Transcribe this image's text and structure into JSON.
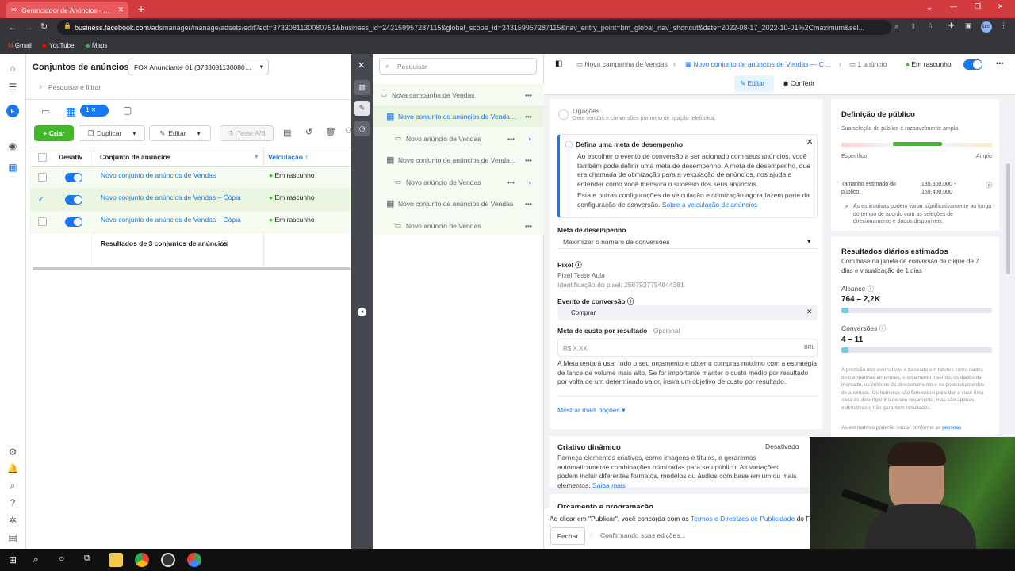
{
  "browser": {
    "tab_title": "Gerenciador de Anúncios - Gere",
    "url_host": "business.facebook.com",
    "url_path": "/adsmanager/manage/adsets/edit?act=3733081130080751&business_id=243159957287115&global_scope_id=243159957287115&nav_entry_point=bm_global_nav_shortcut&date=2022-08-17_2022-10-01%2Cmaximum&sel...",
    "bookmarks": [
      "Gmail",
      "YouTube",
      "Maps"
    ],
    "profile": "bm"
  },
  "panel": {
    "title": "Conjuntos de anúncios",
    "account": "FOX Anunciante 01 (37330811300807...",
    "search_placeholder": "Pesquisar e filtrar",
    "selected_count": "1",
    "toolbar": {
      "create": "+ Criar",
      "duplicate": "Duplicar",
      "edit": "Editar",
      "ab": "Teste A/B"
    },
    "columns": {
      "toggle": "Desativ",
      "name": "Conjunto de anúncios",
      "delivery": "Veiculação ↑"
    },
    "rows": [
      {
        "name": "Novo conjunto de anúncios de Vendas",
        "status": "Em rascunho"
      },
      {
        "name": "Novo conjunto de anúncios de Vendas – Cópia",
        "status": "Em rascunho"
      },
      {
        "name": "Novo conjunto de anúncios de Vendas – Cópia",
        "status": "Em rascunho"
      }
    ],
    "summary": "Resultados de 3 conjuntos de anúncios"
  },
  "tree": {
    "search_placeholder": "Pesquisar",
    "items": [
      {
        "label": "Nova campanha de Vendas",
        "level": 0
      },
      {
        "label": "Novo conjunto de anúncios de Vendas...",
        "level": 1
      },
      {
        "label": "Novo anúncio de Vendas",
        "level": 2
      },
      {
        "label": "Novo conjunto de anúncios de Vendas...",
        "level": 1
      },
      {
        "label": "Novo anúncio de Vendas",
        "level": 2
      },
      {
        "label": "Novo conjunto de anúncios de Vendas",
        "level": 1
      },
      {
        "label": "Novo anúncio de Vendas",
        "level": 2
      }
    ]
  },
  "editor": {
    "breadcrumb": [
      "Nova campanha de Vendas",
      "Novo conjunto de anúncios de Vendas — Cópia",
      "1 anúncio"
    ],
    "status": "Em rascunho",
    "edit_tab": "Editar",
    "review_tab": "Conferir",
    "calls_title": "Ligações",
    "calls_desc": "Gere vendas e conversões por meio de ligação telefônica.",
    "notice_title": "Defina uma meta de desempenho",
    "notice_p1": "Ao escolher o evento de conversão a ser acionado com seus anúncios, você também pode definir uma meta de desempenho. A meta de desempenho, que era chamada de otimização para a veiculação de anúncios, nos ajuda a entender como você mensura o sucesso dos seus anúncios.",
    "notice_p2": "Esta e outras configurações de veiculação e otimização agora fazem parte da configuração de conversão.",
    "notice_link": "Sobre a veiculação de anúncios",
    "goal_label": "Meta de desempenho",
    "goal_value": "Maximizar o número de conversões",
    "pixel_label": "Pixel",
    "pixel_name": "Pixel Teste Aula",
    "pixel_id": "Identificação do pixel: 2587927754844381",
    "event_label": "Evento de conversão",
    "event_value": "Comprar",
    "cost_label": "Meta de custo por resultado",
    "cost_optional": "· Opcional",
    "cost_placeholder": "R$ X,XX",
    "currency": "BRL",
    "cost_help": "A Meta tentará usar todo o seu orçamento e obter o compras máximo com a estratégia de lance de volume mais alto. Se for importante manter o custo médio por resultado por volta de um determinado valor, insira um objetivo de custo por resultado.",
    "more_options": "Mostrar mais opções ▾",
    "dynamic_title": "Criativo dinâmico",
    "dynamic_state": "Desativado",
    "dynamic_desc": "Forneça elementos criativos, como imagens e títulos, e geraremos automaticamente combinações otimizadas para seu público. As variações podem incluir diferentes formatos, modelos ou áudios com base em um ou mais elementos.",
    "dynamic_link": "Saiba mais",
    "budget_title": "Orçamento e programação",
    "footer_text": "Ao clicar em \"Publicar\", você concorda com os",
    "footer_link": "Termos e Diretrizes de Publicidade",
    "footer_tail": "do Fa",
    "close_btn": "Fechar",
    "confirming": "Confirmando suas edições..."
  },
  "audience": {
    "title": "Definição de público",
    "subtitle": "Sua seleção de público é razoavelmente ampla.",
    "left": "Específico",
    "right": "Amplo",
    "size_label": "Tamanho estimado do público:",
    "size_value": "135.500.000 - 159.400.000",
    "note": "As estimativas podem variar significativamente ao longo do tempo de acordo com as seleções de direcionamento e dados disponíveis."
  },
  "results": {
    "title": "Resultados diários estimados",
    "subtitle": "Com base na janela de conversão de clique de 7 dias e visualização de 1 dias",
    "reach_label": "Alcance",
    "reach_value": "764 – 2,2K",
    "conv_label": "Conversões",
    "conv_value": "4 – 11",
    "disclaimer": "A precisão das estimativas é baseada em fatores como dados de campanhas anteriores, o orçamento inserido, os dados de mercado, os critérios de direcionamento e os posicionamentos de anúncios. Os números são fornecidos para dar a você uma ideia de desempenho do seu orçamento, mas são apenas estimativas e não garantem resultados.",
    "disclaimer2": "As estimativas poderão mudar conforme as",
    "disclaimer2_link": "pessoas"
  },
  "colors": {
    "accent": "#1877f2",
    "chrome": "#d33b3f",
    "green": "#42b72a"
  }
}
